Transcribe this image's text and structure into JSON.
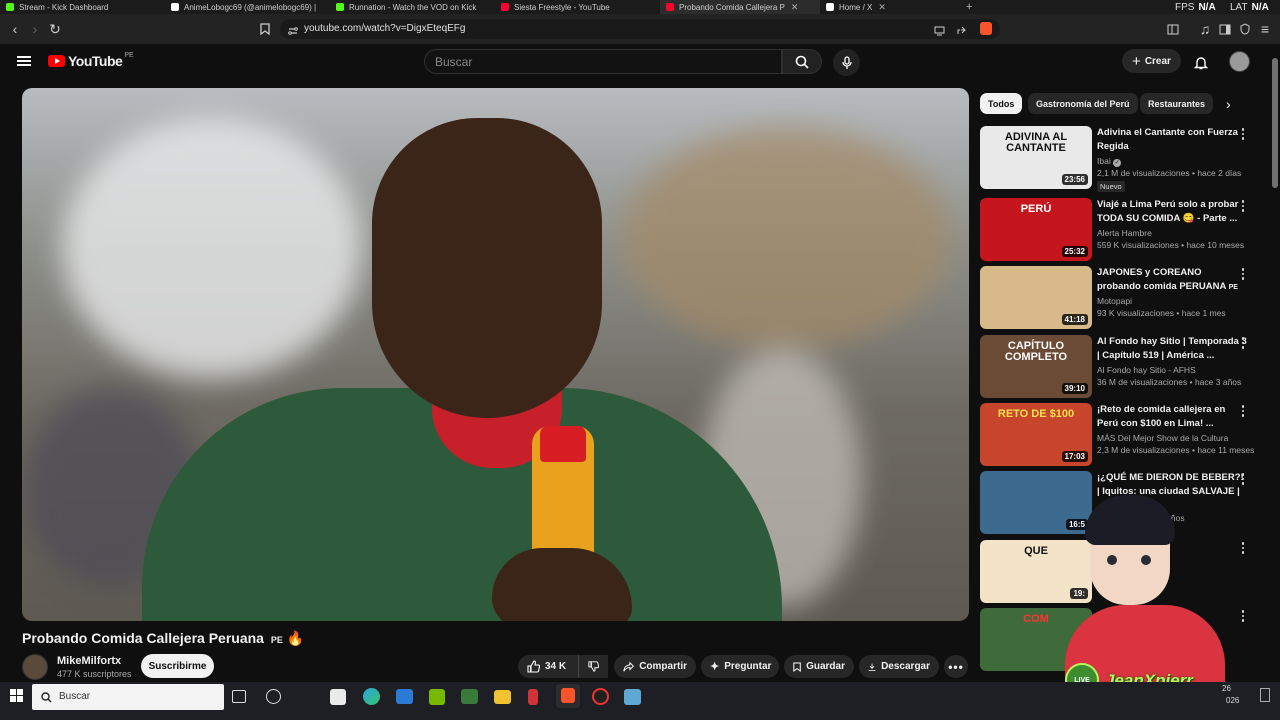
{
  "browser": {
    "tabs": [
      {
        "title": "Stream - Kick Dashboard",
        "active": false,
        "color": "#53fc18"
      },
      {
        "title": "AnimeLobogc69 (@animelobogc69) |",
        "active": false,
        "color": "#ffffff"
      },
      {
        "title": "Runnation - Watch the VOD on Kick",
        "active": false,
        "color": "#53fc18"
      },
      {
        "title": "Siesta Freestyle - YouTube",
        "active": false,
        "color": "#ff0033"
      },
      {
        "title": "Probando Comida Callejera P",
        "active": true,
        "color": "#ff0033"
      },
      {
        "title": "Home / X",
        "active": false,
        "color": "#ffffff"
      }
    ],
    "fps_label": "FPS",
    "fps_value": "N/A",
    "lat_label": "LAT",
    "lat_value": "N/A",
    "url": "youtube.com/watch?v=DigxEteqEFg"
  },
  "header": {
    "logo_text": "YouTube",
    "logo_region": "PE",
    "search_placeholder": "Buscar",
    "create_label": "Crear"
  },
  "video": {
    "title": "Probando Comida Callejera Peruana",
    "title_flag": "PE",
    "title_emoji": "🔥",
    "channel": "MikeMilfortx",
    "subscribers": "477 K suscriptores",
    "subscribe_label": "Suscribirme",
    "likes": "34 K",
    "share_label": "Compartir",
    "ask_label": "Preguntar",
    "save_label": "Guardar",
    "download_label": "Descargar"
  },
  "chips": [
    {
      "label": "Todos",
      "active": true
    },
    {
      "label": "Gastronomía del Perú",
      "active": false
    },
    {
      "label": "Restaurantes",
      "active": false
    }
  ],
  "recommendations": [
    {
      "title": "Adivina el Cantante con Fuerza Regida",
      "channel": "Ibai",
      "verified": true,
      "views": "2,1 M de visualizaciones",
      "ago": "hace 2 días",
      "duration": "23:56",
      "badge": "Nuevo",
      "thumb_text": "ADIVINA AL CANTANTE",
      "thumb_bg": "#e9e9e9",
      "thumb_fg": "#111111"
    },
    {
      "title": "Viajé a Lima Perú solo a probar TODA SU COMIDA 😋 - Parte ...",
      "channel": "Alerta Hambre",
      "verified": false,
      "views": "559 K visualizaciones",
      "ago": "hace 10 meses",
      "duration": "25:32",
      "badge": "",
      "thumb_text": "PERÚ",
      "thumb_bg": "#c4161c",
      "thumb_fg": "#ffffff"
    },
    {
      "title": "JAPONES y COREANO probando comida PERUANA",
      "title_flag": "PE",
      "channel": "Motopapi",
      "verified": false,
      "views": "93 K visualizaciones",
      "ago": "hace 1 mes",
      "duration": "41:18",
      "badge": "",
      "thumb_text": "",
      "thumb_bg": "#d8b98a",
      "thumb_fg": "#ffffff"
    },
    {
      "title": "Al Fondo hay Sitio | Temporada 3 | Capítulo 519 | América ...",
      "channel": "Al Fondo hay Sitio - AFHS",
      "verified": false,
      "views": "36 M de visualizaciones",
      "ago": "hace 3 años",
      "duration": "39:10",
      "badge": "",
      "thumb_text": "CAPÍTULO COMPLETO",
      "thumb_bg": "#6b4a36",
      "thumb_fg": "#ffffff"
    },
    {
      "title": "¡Reto de comida callejera en Perú con $100 en Lima! ...",
      "channel": "MÁS Del Mejor Show de la Cultura",
      "verified": false,
      "views": "2,3 M de visualizaciones",
      "ago": "hace 11 meses",
      "duration": "17:03",
      "badge": "",
      "thumb_text": "RETO DE $100",
      "thumb_bg": "#c7452a",
      "thumb_fg": "#ffe14d"
    },
    {
      "title": "¡¿QUÉ ME DIERON DE BEBER?! | Iquitos: una ciudad SALVAJE | ...",
      "channel": "...ica",
      "verified": true,
      "views": "...iciones",
      "ago": "hace 3 años",
      "duration": "16:5",
      "badge": "",
      "thumb_text": "",
      "thumb_bg": "#3d6b8f",
      "thumb_fg": "#ffffff"
    },
    {
      "title": "...da Callejera:",
      "channel": "",
      "verified": false,
      "views": "",
      "ago": "hace 3 semanas",
      "duration": "19:",
      "badge": "",
      "thumb_text": "QUE",
      "thumb_bg": "#f2e3c9",
      "thumb_fg": "#111111"
    },
    {
      "title": "...te ...",
      "channel": "",
      "verified": false,
      "views": "",
      "ago": "...es",
      "duration": "",
      "badge": "",
      "thumb_text": "COM",
      "thumb_bg": "#3f6a3a",
      "thumb_fg": "#ff3333"
    }
  ],
  "overlay": {
    "streamer_name": "JeanXpierr",
    "live_label": "LIVE"
  },
  "taskbar": {
    "search_label": "Buscar",
    "clock_fragment": "26",
    "date_fragment": "026"
  }
}
